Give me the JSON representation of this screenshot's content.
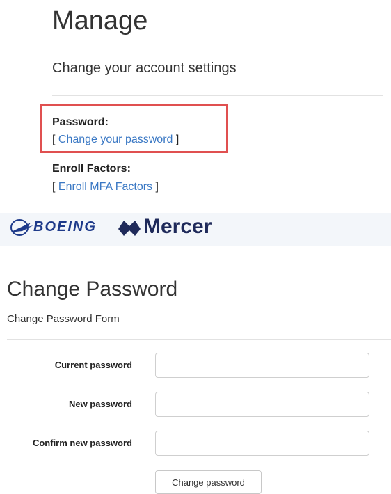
{
  "manage": {
    "title": "Manage",
    "subtitle": "Change your account settings",
    "password_label": "Password:",
    "password_link_open": "[ ",
    "password_link": "Change your password",
    "password_link_close": " ]",
    "enroll_label": "Enroll Factors:",
    "enroll_link_open": "[ ",
    "enroll_link": "Enroll MFA Factors",
    "enroll_link_close": " ]",
    "highlight_color": "#e05050",
    "link_color": "#3a78c4"
  },
  "banner": {
    "boeing": "BOEING",
    "mercer": "Mercer",
    "boeing_color": "#1e3a8a",
    "mercer_color": "#1f2a5a",
    "icons": [
      "boeing-logo-icon",
      "mercer-logo-icon"
    ]
  },
  "change_password": {
    "title": "Change Password",
    "subtitle": "Change Password Form",
    "fields": [
      {
        "label": "Current password",
        "value": ""
      },
      {
        "label": "New password",
        "value": ""
      },
      {
        "label": "Confirm new password",
        "value": ""
      }
    ],
    "submit_label": "Change password"
  }
}
